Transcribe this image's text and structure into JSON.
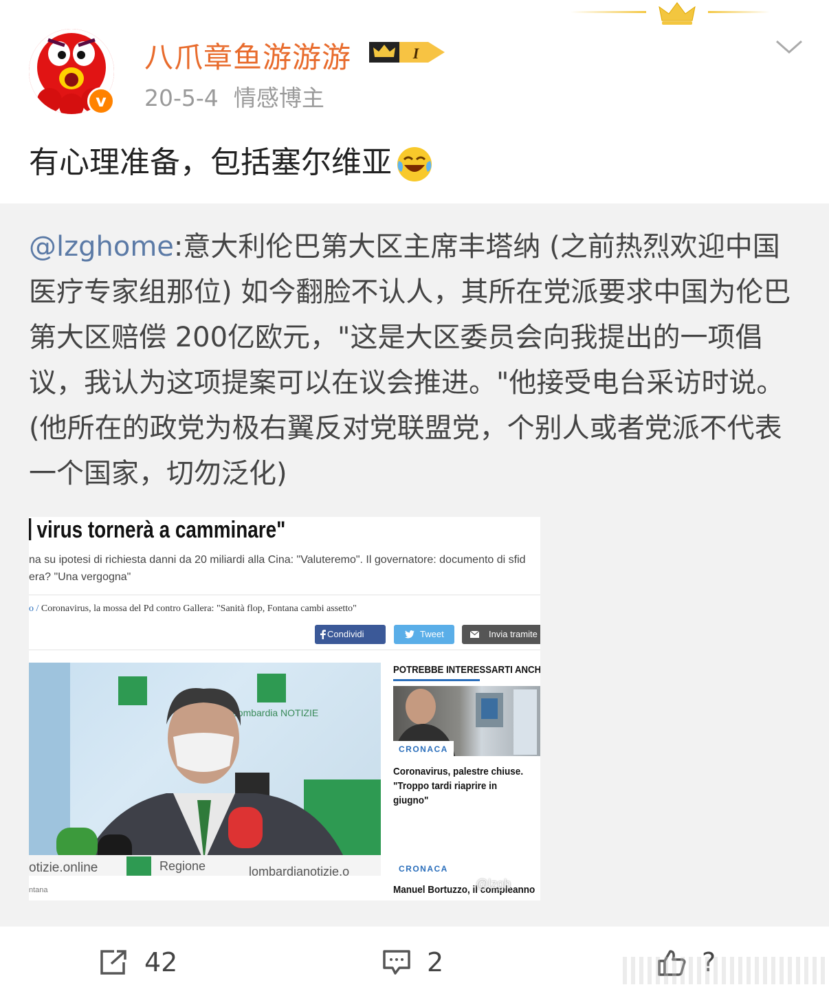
{
  "post": {
    "author": "八爪章鱼游游游",
    "date": "20-5-4",
    "author_tag": "情感博主",
    "verified_badge": "v",
    "user_badge_level": "I",
    "text": "有心理准备，包括塞尔维亚",
    "emoji": "laughing-crying"
  },
  "repost": {
    "mention": "@lzghome",
    "text": ":意大利伦巴第大区主席丰塔纳 (之前热烈欢迎中国医疗专家组那位) 如今翻脸不认人，其所在党派要求中国为伦巴第大区赔偿 200亿欧元，\"这是大区委员会向我提出的一项倡议，我认为这项提案可以在议会推进。\"他接受电台采访时说。(他所在的政党为极右翼反对党联盟党，个别人或者党派不代表一个国家，切勿泛化)"
  },
  "embedded": {
    "headline": "virus tornerà a camminare\"",
    "subtitle_line1": "na su ipotesi di richiesta danni da 20 miliardi alla Cina: \"Valuteremo\". Il governatore: documento di sfid",
    "subtitle_line2": "era? \"Una vergogna\"",
    "breadcrumb_home": "o /",
    "breadcrumb_text": "Coronavirus, la mossa del Pd contro Gallera: \"Sanità flop, Fontana cambi assetto\"",
    "share_facebook": "Condividi",
    "share_twitter": "Tweet",
    "share_email": "Invia tramite e",
    "photo_caption": "ntana",
    "photo_sign_left": "otizie.online",
    "photo_sign_regione": "Regione",
    "photo_sign_right": "lombardianotizie.o",
    "photo_logo_text": "Lombardia NOTIZIE",
    "sidebar_title": "POTREBBE INTERESSARTI ANCHE",
    "tag1": "CRONACA",
    "article1_title": "Coronavirus, palestre chiuse. \"Troppo tardi riaprire in giugno\"",
    "tag2": "CRONACA",
    "article2_title": "Manuel Bortuzzo, il compleanno",
    "watermark": "@lzgh"
  },
  "footer": {
    "share_count": "42",
    "comment_count": "2",
    "like_count": "?"
  },
  "colors": {
    "username": "#e86b2c",
    "mention": "#5b7aa6",
    "verified": "#ff8200",
    "repost_bg": "#f2f2f2"
  }
}
